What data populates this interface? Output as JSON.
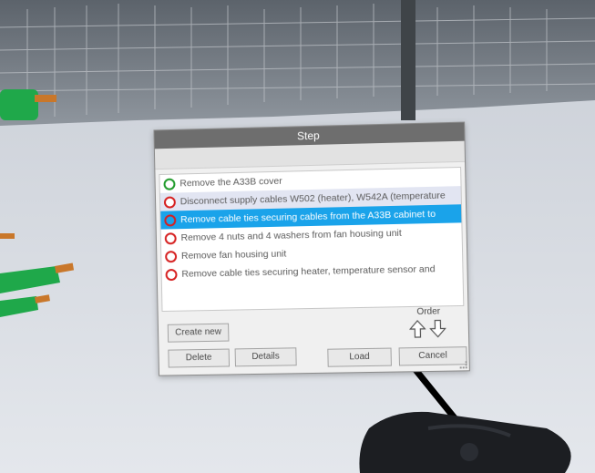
{
  "panel": {
    "title": "Step",
    "steps": [
      {
        "label": "Remove the A33B cover",
        "status": "done"
      },
      {
        "label": "Disconnect supply cables W502 (heater), W542A (temperature",
        "status": "todo"
      },
      {
        "label": "Remove cable ties securing cables from the A33B cabinet to",
        "status": "todo"
      },
      {
        "label": "Remove 4 nuts and 4 washers from fan housing unit",
        "status": "todo"
      },
      {
        "label": "Remove fan housing unit",
        "status": "todo"
      },
      {
        "label": "Remove cable ties securing heater, temperature sensor and",
        "status": "todo"
      }
    ],
    "create_new_label": "Create new",
    "delete_label": "Delete",
    "details_label": "Details",
    "load_label": "Load",
    "cancel_label": "Cancel",
    "order_label": "Order"
  },
  "colors": {
    "selected": "#1aa3ea",
    "done": "#1f9a2a",
    "todo": "#d62020"
  }
}
